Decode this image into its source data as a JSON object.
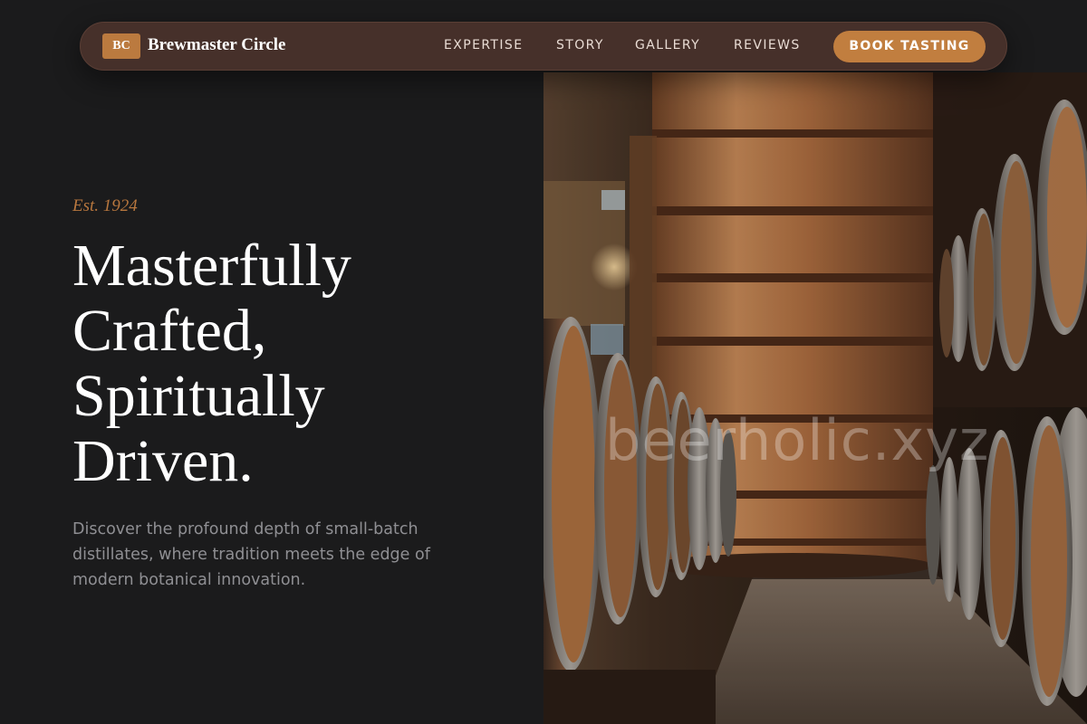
{
  "nav": {
    "logo_badge": "BC",
    "brand": "Brewmaster Circle",
    "links": [
      "EXPERTISE",
      "STORY",
      "GALLERY",
      "REVIEWS"
    ],
    "cta_label": "BOOK TASTING"
  },
  "hero": {
    "eyebrow": "Est. 1924",
    "headline_lines": [
      "Masterfully",
      "Crafted,",
      "Spiritually",
      "Driven."
    ],
    "description": "Discover the profound depth of small-batch distillates, where tradition meets the edge of modern botanical innovation."
  },
  "image": {
    "watermark": "beerholic.xyz"
  },
  "colors": {
    "background": "#1b1b1c",
    "nav_background": "#46302a",
    "accent": "#c17e3f",
    "eyebrow": "#b8773e",
    "body_text": "#8f8f93"
  }
}
